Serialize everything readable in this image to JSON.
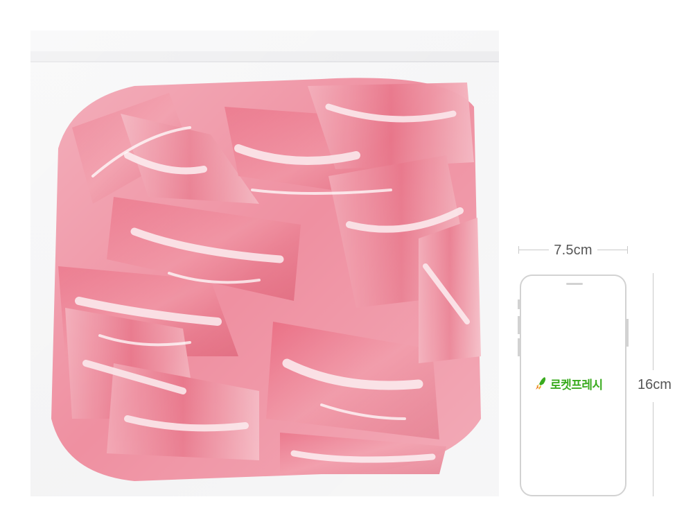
{
  "product_photo": {
    "subject": "sliced pork in clear plastic bag"
  },
  "size_reference": {
    "width_label": "7.5cm",
    "height_label": "16cm",
    "brand_text": "로켓프레시",
    "brand_color": "#3aab1f",
    "icon": "rocket-icon"
  }
}
